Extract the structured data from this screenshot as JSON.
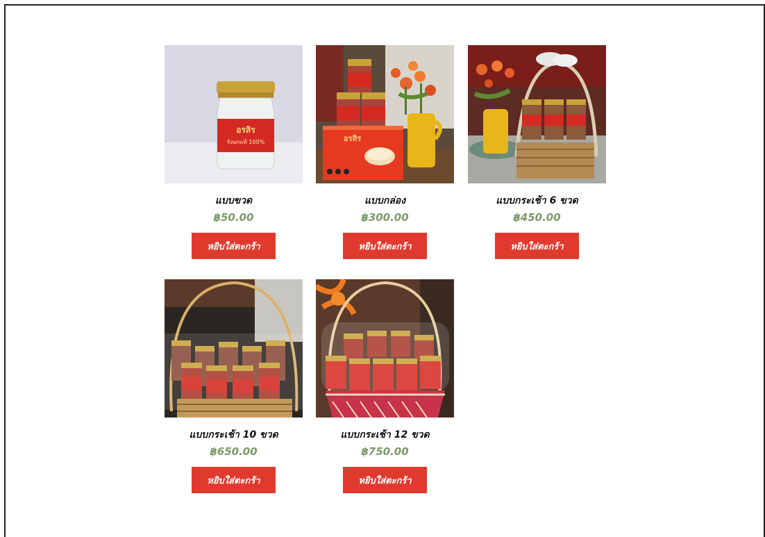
{
  "products": [
    {
      "name": "แบบขวด",
      "price": "฿50.00",
      "button": "หยิบใส่ตะกร้า"
    },
    {
      "name": "แบบกล่อง",
      "price": "฿300.00",
      "button": "หยิบใส่ตะกร้า"
    },
    {
      "name": "แบบกระเช้า 6 ขวด",
      "price": "฿450.00",
      "button": "หยิบใส่ตะกร้า"
    },
    {
      "name": "แบบกระเช้า 10 ขวด",
      "price": "฿650.00",
      "button": "หยิบใส่ตะกร้า"
    },
    {
      "name": "แบบกระเช้า 12 ขวด",
      "price": "฿750.00",
      "button": "หยิบใส่ตะกร้า"
    }
  ],
  "jar_label": {
    "brand": "อรสิร",
    "sub": "รังนกแท้ 100%"
  },
  "colors": {
    "button": "#e03a2f",
    "price": "#7c9a68",
    "label_red": "#d42a22",
    "lid_gold": "#c9a23a"
  }
}
